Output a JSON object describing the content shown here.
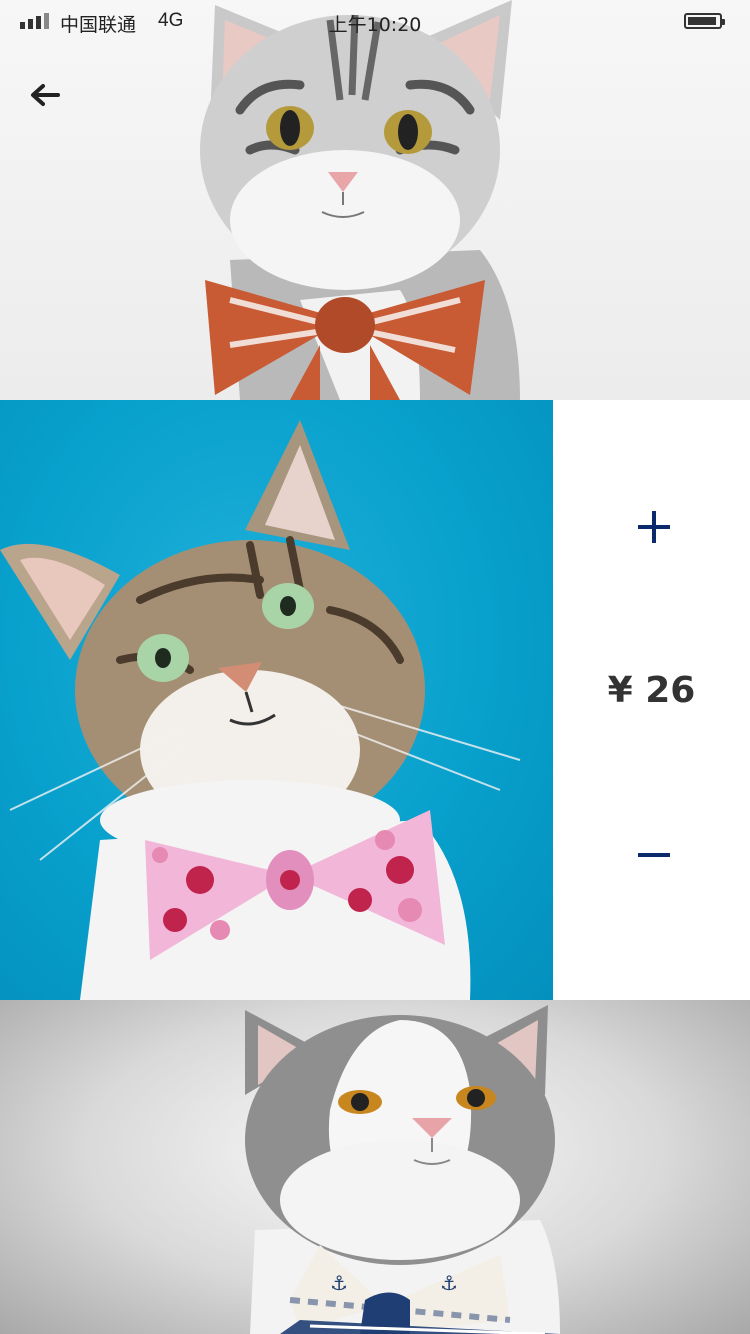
{
  "status_bar": {
    "carrier": "中国联通",
    "network": "4G",
    "time": "上午10:20"
  },
  "nav": {
    "back_icon": "back-arrow-icon"
  },
  "product": {
    "price": "¥ 26",
    "increase_icon": "plus-icon",
    "decrease_icon": "minus-icon"
  },
  "photos": [
    {
      "subject": "silver tabby cat with orange striped bow",
      "background": "#f0f0f0"
    },
    {
      "subject": "tabby cat with pink heart bow tie",
      "background": "#0aa3cf"
    },
    {
      "subject": "grey and white cat with anchor bow tie",
      "background": "#d9d9d9"
    }
  ],
  "colors": {
    "accent": "#0b2a6b",
    "price_text": "#333333"
  }
}
